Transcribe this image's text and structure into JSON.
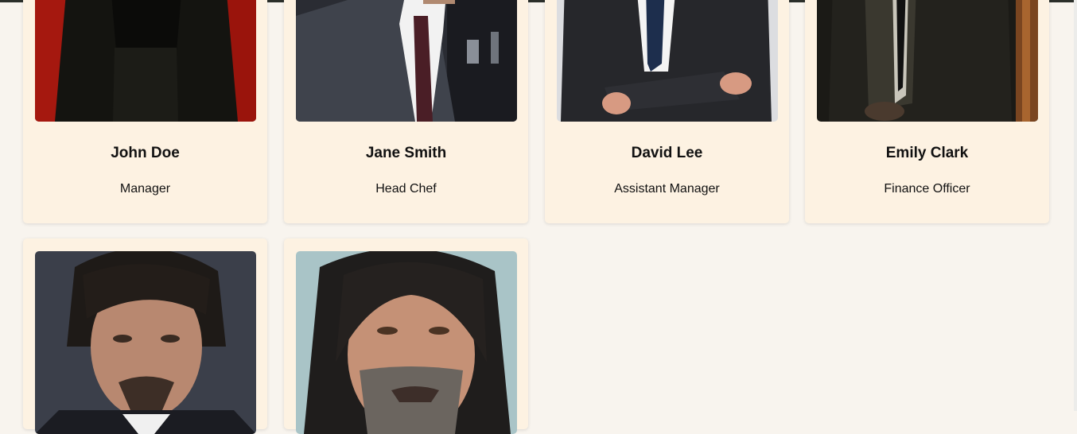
{
  "team": [
    {
      "name": "John Doe",
      "role": "Manager",
      "photo": "man-in-dark-suit-red-background"
    },
    {
      "name": "Jane Smith",
      "role": "Head Chef",
      "photo": "man-in-suit-dark-tie"
    },
    {
      "name": "David Lee",
      "role": "Assistant Manager",
      "photo": "man-in-suit-arms-crossed"
    },
    {
      "name": "Emily Clark",
      "role": "Finance Officer",
      "photo": "man-in-dark-suit-doorway"
    },
    {
      "name": "",
      "role": "",
      "photo": "man-with-goatee-portrait"
    },
    {
      "name": "",
      "role": "",
      "photo": "man-with-long-hair-portrait"
    }
  ],
  "colors": {
    "page_bg": "#f8f4ee",
    "card_bg": "#fdf2e2",
    "text": "#111111"
  }
}
